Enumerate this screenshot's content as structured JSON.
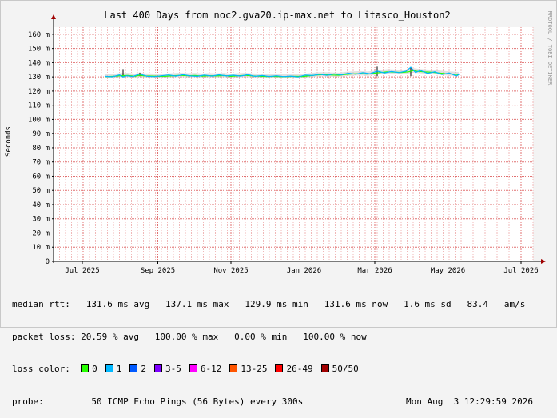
{
  "chart_data": {
    "type": "line",
    "title": "Last 400 Days from noc2.gva20.ip-max.net to Litasco_Houston2",
    "ylabel": "Seconds",
    "side_label": "RRDTOOL / TOBI OETIKER",
    "ylim": [
      0,
      165
    ],
    "y_ticks": [
      0,
      10,
      20,
      30,
      40,
      50,
      60,
      70,
      80,
      90,
      100,
      110,
      120,
      130,
      140,
      150,
      160
    ],
    "y_tick_labels": [
      "0",
      "10 m",
      "20 m",
      "30 m",
      "40 m",
      "50 m",
      "60 m",
      "70 m",
      "80 m",
      "90 m",
      "100 m",
      "110 m",
      "120 m",
      "130 m",
      "140 m",
      "150 m",
      "160 m"
    ],
    "xlim": [
      0,
      400
    ],
    "x_ticks": [
      {
        "x": 24,
        "label": "Jul 2025"
      },
      {
        "x": 87,
        "label": "Sep 2025"
      },
      {
        "x": 148,
        "label": "Nov 2025"
      },
      {
        "x": 209,
        "label": "Jan 2026"
      },
      {
        "x": 268,
        "label": "Mar 2026"
      },
      {
        "x": 329,
        "label": "May 2026"
      },
      {
        "x": 390,
        "label": "Jul 2026"
      }
    ],
    "x_minor_step": 5,
    "series": [
      {
        "loss_bucket": "0",
        "x": [
          43,
          50,
          56,
          62,
          68,
          72,
          76,
          82,
          88,
          94,
          100,
          106,
          112,
          118,
          124,
          130,
          136,
          142,
          148,
          154,
          160,
          166,
          172,
          178,
          184,
          190,
          196,
          202,
          208,
          214,
          220,
          226,
          232,
          238,
          244,
          250,
          256,
          262,
          268,
          272,
          278,
          284,
          290,
          296,
          300,
          304,
          310,
          316,
          322,
          328,
          334,
          338
        ],
        "y": [
          130.2,
          130.4,
          130.9,
          131.0,
          130.5,
          131.2,
          130.7,
          130.6,
          130.4,
          130.5,
          130.9,
          131.1,
          130.8,
          131.0,
          130.6,
          130.9,
          130.7,
          131.0,
          130.4,
          130.8,
          131.1,
          130.7,
          130.5,
          130.3,
          130.4,
          130.2,
          130.3,
          130.4,
          130.3,
          130.9,
          131.4,
          131.6,
          131.3,
          131.2,
          131.8,
          132.1,
          132.3,
          132.0,
          132.6,
          133.0,
          133.6,
          133.4,
          133.1,
          133.6,
          134.4,
          133.9,
          133.5,
          133.3,
          132.7,
          132.2,
          131.9,
          131.6
        ]
      },
      {
        "loss_bucket": "1",
        "x": [
          43,
          49,
          55,
          58,
          61,
          66,
          72,
          78,
          84,
          90,
          96,
          102,
          108,
          114,
          120,
          126,
          132,
          138,
          144,
          150,
          156,
          162,
          168,
          174,
          180,
          186,
          192,
          198,
          204,
          210,
          216,
          222,
          228,
          234,
          240,
          246,
          252,
          258,
          264,
          270,
          276,
          282,
          288,
          294,
          298,
          302,
          306,
          312,
          318,
          324,
          330,
          336,
          339
        ],
        "y": [
          130.4,
          130.1,
          131.4,
          130.0,
          130.8,
          130.3,
          132.0,
          130.5,
          130.2,
          130.8,
          131.4,
          130.6,
          131.6,
          130.7,
          130.4,
          131.3,
          130.6,
          131.5,
          130.7,
          131.2,
          130.6,
          131.6,
          130.4,
          131.0,
          130.3,
          130.8,
          130.2,
          130.6,
          130.0,
          131.3,
          131.0,
          131.9,
          131.1,
          132.1,
          131.5,
          132.6,
          131.9,
          133.0,
          132.2,
          134.1,
          132.8,
          133.8,
          133.0,
          134.0,
          136.8,
          133.1,
          134.6,
          132.5,
          133.6,
          131.7,
          132.8,
          130.6,
          132.3
        ]
      }
    ],
    "spikes": [
      {
        "x": 58,
        "y": 135.5
      },
      {
        "x": 72,
        "y": 133.0
      },
      {
        "x": 270,
        "y": 137.2
      },
      {
        "x": 298,
        "y": 136.5
      }
    ],
    "grid": true,
    "colors": {
      "background": "#f3f3f3",
      "plot_bg": "#ffffff",
      "minor_grid": "#f0b8b8",
      "major_grid": "#e07070",
      "axis": "#000000",
      "arrow": "#a00000",
      "smoke": "#c8c8c8"
    }
  },
  "stats": {
    "median_rtt": "median rtt:   131.6 ms avg   137.1 ms max   129.9 ms min   131.6 ms now   1.6 ms sd   83.4   am/s",
    "packet_loss": "packet loss: 20.59 % avg   100.00 % max   0.00 % min   100.00 % now"
  },
  "loss_color": {
    "label": "loss color:",
    "items": [
      {
        "label": "0",
        "color": "#26ff00"
      },
      {
        "label": "1",
        "color": "#00b8ff"
      },
      {
        "label": "2",
        "color": "#0059ff"
      },
      {
        "label": "3-5",
        "color": "#7e00ff"
      },
      {
        "label": "6-12",
        "color": "#ff00ff"
      },
      {
        "label": "13-25",
        "color": "#ff5500"
      },
      {
        "label": "26-49",
        "color": "#ff0000"
      },
      {
        "label": "50/50",
        "color": "#a10000"
      }
    ]
  },
  "probe": {
    "label": "probe:",
    "text": "50 ICMP Echo Pings (56 Bytes) every 300s",
    "date": "Mon Aug  3 12:29:59 2026"
  }
}
